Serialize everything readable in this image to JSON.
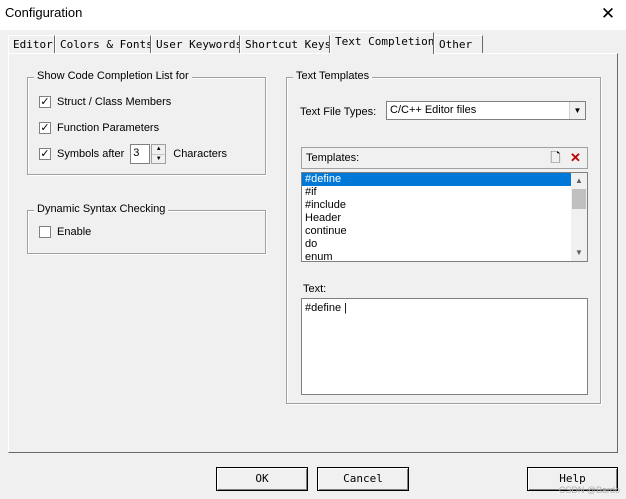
{
  "window": {
    "title": "Configuration",
    "close_glyph": "✕"
  },
  "tabs": [
    {
      "label": "Editor"
    },
    {
      "label": "Colors & Fonts"
    },
    {
      "label": "User Keywords"
    },
    {
      "label": "Shortcut Keys"
    },
    {
      "label": "Text Completion",
      "active": true
    },
    {
      "label": "Other"
    }
  ],
  "completion_group": {
    "legend": "Show Code Completion List for",
    "struct_members": {
      "label": "Struct / Class Members",
      "checked": true
    },
    "function_params": {
      "label": "Function Parameters",
      "checked": true
    },
    "symbols_after": {
      "label": "Symbols after",
      "value": "3",
      "suffix": "Characters",
      "checked": true
    }
  },
  "syntax_group": {
    "legend": "Dynamic Syntax Checking",
    "enable": {
      "label": "Enable",
      "checked": false
    }
  },
  "templates_group": {
    "legend": "Text Templates",
    "file_types_label": "Text File Types:",
    "file_types_value": "C/C++ Editor files",
    "templates_label": "Templates:",
    "new_icon": "new-template-icon",
    "delete_icon": "delete-template-icon",
    "items": [
      "#define",
      "#if",
      "#include",
      "Header",
      "continue",
      "do",
      "enum"
    ],
    "selected_index": 0,
    "text_label": "Text:",
    "text_value": "#define |"
  },
  "buttons": {
    "ok": "OK",
    "cancel": "Cancel",
    "help": "Help"
  },
  "watermark": "CSDN @Bardo"
}
